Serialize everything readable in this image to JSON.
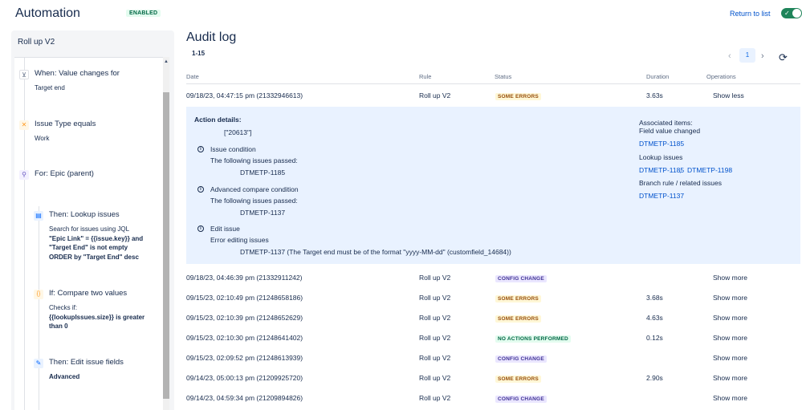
{
  "header": {
    "title": "Automation",
    "badge": "ENABLED",
    "return_link": "Return to list",
    "toggle_on": true,
    "toggle_color": "#1f845a"
  },
  "rule_panel": {
    "name": "Roll up V2",
    "nodes": [
      {
        "icon": "trigger-icon",
        "title": "When: Value changes for",
        "sub": [
          "Target end"
        ]
      },
      {
        "icon": "condition-icon",
        "title": "Issue Type equals",
        "sub": [
          "Work"
        ]
      },
      {
        "icon": "branch-icon",
        "title": "For: Epic (parent)",
        "sub": []
      },
      {
        "icon": "lookup-icon",
        "title": "Then: Lookup issues",
        "sub": [
          "Search for issues using JQL",
          "\"Epic Link\" = {{issue.key}} and",
          "\"Target End\" is not empty",
          "ORDER by \"Target End\" desc"
        ]
      },
      {
        "icon": "if-icon",
        "title": "If: Compare two values",
        "sub": [
          "Checks if:",
          "{{lookupIssues.size}} is greater",
          "than 0"
        ]
      },
      {
        "icon": "edit-icon",
        "title": "Then: Edit issue fields",
        "sub": [
          "Advanced"
        ]
      }
    ]
  },
  "audit": {
    "title": "Audit log",
    "range": "1-15",
    "page": "1",
    "columns": {
      "date": "Date",
      "rule": "Rule",
      "status": "Status",
      "duration": "Duration",
      "operations": "Operations"
    },
    "rows": [
      {
        "date": "09/18/23, 04:47:15 pm (21332946613)",
        "rule": "Roll up V2",
        "status": "SOME ERRORS",
        "duration": "3.63s",
        "op": "Show less"
      },
      {
        "date": "09/18/23, 04:46:39 pm (21332911242)",
        "rule": "Roll up V2",
        "status": "CONFIG CHANGE",
        "duration": "",
        "op": "Show more"
      },
      {
        "date": "09/15/23, 02:10:49 pm (21248658186)",
        "rule": "Roll up V2",
        "status": "SOME ERRORS",
        "duration": "3.68s",
        "op": "Show more"
      },
      {
        "date": "09/15/23, 02:10:39 pm (21248652629)",
        "rule": "Roll up V2",
        "status": "SOME ERRORS",
        "duration": "4.63s",
        "op": "Show more"
      },
      {
        "date": "09/15/23, 02:10:30 pm (21248641402)",
        "rule": "Roll up V2",
        "status": "NO ACTIONS PERFORMED",
        "duration": "0.12s",
        "op": "Show more"
      },
      {
        "date": "09/15/23, 02:09:52 pm (21248613939)",
        "rule": "Roll up V2",
        "status": "CONFIG CHANGE",
        "duration": "",
        "op": "Show more"
      },
      {
        "date": "09/14/23, 05:00:13 pm (21209925720)",
        "rule": "Roll up V2",
        "status": "SOME ERRORS",
        "duration": "2.90s",
        "op": "Show more"
      },
      {
        "date": "09/14/23, 04:59:34 pm (21209894826)",
        "rule": "Roll up V2",
        "status": "CONFIG CHANGE",
        "duration": "",
        "op": "Show more"
      }
    ],
    "status_colors": {
      "SOME ERRORS": {
        "fg": "#974f0c",
        "bg": "#fff7d6"
      },
      "CONFIG CHANGE": {
        "fg": "#403294",
        "bg": "#eae6ff"
      },
      "NO ACTIONS PERFORMED": {
        "fg": "#006644",
        "bg": "#e3fcef"
      }
    },
    "details": {
      "action_label": "Action details:",
      "action_value": "[\"20613\"]",
      "issue_condition": "Issue condition",
      "passed_1": "The following issues passed:",
      "passed_1_issue": "DTMETP-1185",
      "advanced_condition": "Advanced compare condition",
      "passed_2": "The following issues passed:",
      "passed_2_issue": "DTMETP-1137",
      "edit_issue": "Edit issue",
      "error_editing": "Error editing issues",
      "error_msg": "DTMETP-1137 (The Target end must be of the format \"yyyy-MM-dd\" (customfield_14684))",
      "assoc_label": "Associated items:",
      "field_value_changed": "Field value changed",
      "field_link": "DTMETP-1185",
      "lookup_issues": "Lookup issues",
      "lookup_link_1": "DTMETP-1185",
      "lookup_sep": ",",
      "lookup_link_2": "DTMETP-1198",
      "branch_label": "Branch rule / related issues",
      "branch_link": "DTMETP-1137"
    }
  }
}
